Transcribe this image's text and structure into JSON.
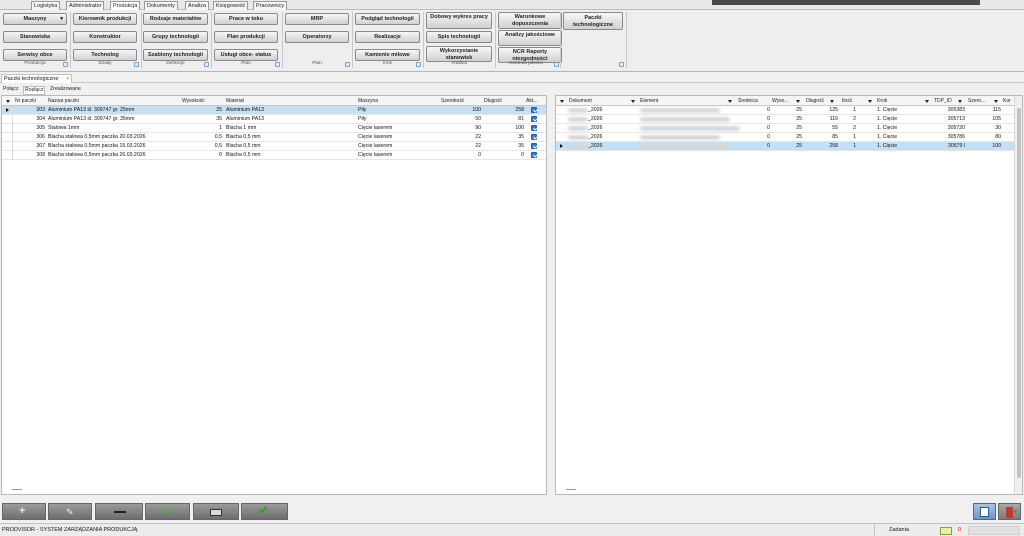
{
  "menu": {
    "tabs": [
      "Logistyka",
      "Administrator",
      "Produkcja",
      "Dokumenty",
      "Analiza",
      "Księgowość",
      "Pracownicy"
    ],
    "active": "Produkcja"
  },
  "ribbon": {
    "buttons": {
      "maszyny": "Maszyny",
      "stanowiska": "Stanowiska",
      "serwisy": "Serwisy obce",
      "kierownik": "Kierownik produkcji",
      "konstruktor": "Konstruktor",
      "technolog": "Technolog",
      "rodzaje": "Rodzaje materiałów",
      "grupy": "Grupy technologii",
      "szablony": "Szablony technologii",
      "prace": "Prace w toku",
      "plan": "Plan produkcji",
      "uslugi": "Usługi obce- status",
      "mrp": "MRP",
      "operatorzy": "Operatorzy",
      "podglad": "Podgląd technologii",
      "realizacje": "Realizacje",
      "kamienie": "Kamienie milowe",
      "dobowy": "Dobowy wykres pracy",
      "spis": "Spis technologii",
      "wykorzystanie": "Wykorzystanie stanowisk",
      "warunkowe": "Warunkowe dopuszczenia",
      "analizy": "Analizy jakościowe",
      "ncr": "NCR Raporty niezgodności",
      "paczki": "Paczki technologiczne"
    },
    "groups": {
      "produkcja": "Produkcja",
      "dzialy": "Działy",
      "definicje": "Definicje",
      "plan": "Plan",
      "plan2": "Plan",
      "inne": "Inne",
      "analiza": "Analiza",
      "kontrola": "Kontrola jakości"
    }
  },
  "doc_tab": {
    "label": "Paczki technologiczne",
    "close": "×"
  },
  "sub_tabs": {
    "polacz": "Połącz",
    "rozlacz": "Rozłącz",
    "zrealizowane": "Zrealizowane"
  },
  "left_grid": {
    "columns": [
      "Nr paczki",
      "Nazwa paczki",
      "Wysokość",
      "Materiał",
      "Maszyna",
      "Szerokość",
      "Długość",
      "Akt..."
    ],
    "rows": [
      {
        "nr": "303",
        "nazwa": "Aluminium PA13 śl. 309747 gr. 25mm",
        "wys": "25",
        "mat": "Aluminium PA13",
        "maszyna": "Piły",
        "szer": "100",
        "dl": "258",
        "sel": true
      },
      {
        "nr": "304",
        "nazwa": "Aluminium PA13 śl. 309747 gr. 35mm",
        "wys": "35",
        "mat": "Aluminium PA13",
        "maszyna": "Piły",
        "szer": "50",
        "dl": "81",
        "sel": false
      },
      {
        "nr": "305",
        "nazwa": "Stalowa 1mm",
        "wys": "1",
        "mat": "Blacha 1 mm",
        "maszyna": "Cięcie laserem",
        "szer": "90",
        "dl": "100",
        "sel": false
      },
      {
        "nr": "306",
        "nazwa": "Blacha stalowa 0,5mm paczka 20.03.2026",
        "wys": "0,5",
        "mat": "Blacha 0,5 mm",
        "maszyna": "Cięcie laserem",
        "szer": "22",
        "dl": "35",
        "sel": false
      },
      {
        "nr": "307",
        "nazwa": "Blacha stalowa 0,5mm paczka 15.03.2026",
        "wys": "0,5",
        "mat": "Blacha 0,5 mm",
        "maszyna": "Cięcie laserem",
        "szer": "22",
        "dl": "35",
        "sel": false
      },
      {
        "nr": "308",
        "nazwa": "Blacha stalowa 0,5mm paczka 26.03.2026",
        "wys": "0",
        "mat": "Blacha 0,5 mm",
        "maszyna": "Cięcie laserem",
        "szer": "0",
        "dl": "0",
        "sel": false
      }
    ]
  },
  "right_grid": {
    "columns": [
      "Dokument",
      "Element",
      "Średnica",
      "Wyso...",
      "Długość",
      "Ilość",
      "Krok",
      "TDP_ID",
      "Szero...",
      "Kor"
    ],
    "rows": [
      {
        "dok": "_2026",
        "sr": "0",
        "wys": "25",
        "dl": "125",
        "il": "1",
        "krok": "1. Cięcie",
        "tdp": "305383",
        "szer": "115",
        "sel": false
      },
      {
        "dok": "_2026",
        "sr": "0",
        "wys": "25",
        "dl": "116",
        "il": "2",
        "krok": "1. Cięcie",
        "tdp": "305713",
        "szer": "105",
        "sel": false
      },
      {
        "dok": "_2026",
        "sr": "0",
        "wys": "25",
        "dl": "55",
        "il": "2",
        "krok": "1. Cięcie",
        "tdp": "305720",
        "szer": "30",
        "sel": false
      },
      {
        "dok": "_2026",
        "sr": "0",
        "wys": "25",
        "dl": "85",
        "il": "1",
        "krok": "1. Cięcie",
        "tdp": "305786",
        "szer": "80",
        "sel": false
      },
      {
        "dok": "_2026",
        "sr": "0",
        "wys": "25",
        "dl": "258",
        "il": "1",
        "krok": "1. Cięcie",
        "tdp": "30579 l",
        "szer": "100",
        "sel": true
      }
    ]
  },
  "status": {
    "app": "PRODVISOR - SYSTEM ZARZĄDZANIA PRODUKCJĄ",
    "zadania": "Zadania",
    "count": "0"
  },
  "colors": {
    "selection": "#c5e0f5",
    "accent": "#2f7bd6",
    "toolbar_green": "#3c9a2c"
  }
}
